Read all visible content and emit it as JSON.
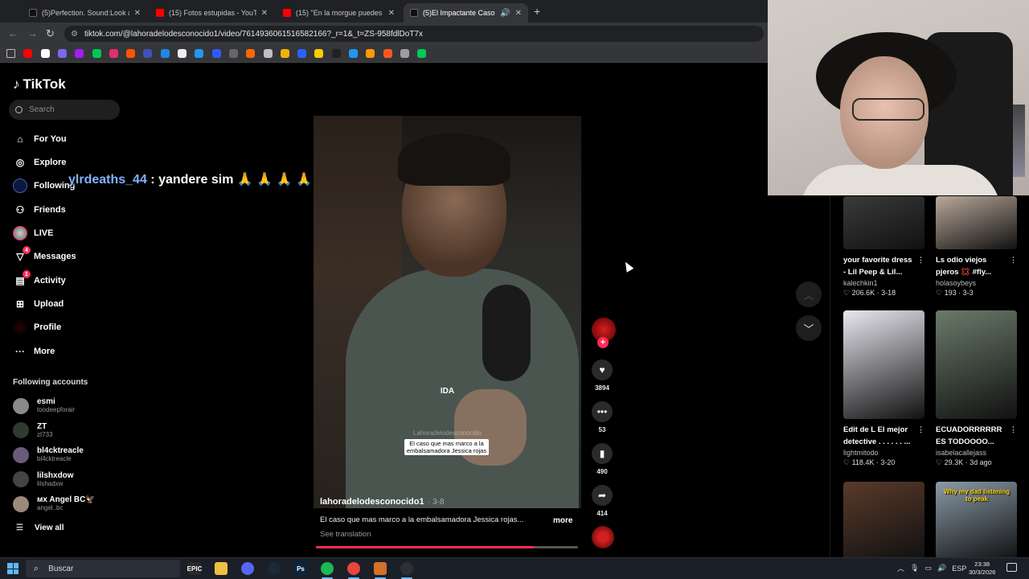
{
  "browser": {
    "tabs": [
      {
        "title": "(5)Perfection. Sound:Look at Me",
        "favicon_color": "#111111",
        "active": false
      },
      {
        "title": "(15) Fotos estupidas - YouTube",
        "favicon_color": "#ff0000",
        "active": false
      },
      {
        "title": "(15) \"En la morgue puedes ver",
        "favicon_color": "#ff0000",
        "active": false
      },
      {
        "title": "(5)El Impactante Caso de Je",
        "favicon_color": "#111111",
        "active": true
      }
    ],
    "url": "tiktok.com/@lahoradelodesconocido1/video/7614936061516582166?_r=1&_t=ZS-958fdlDoT7x",
    "bookmark_colors": [
      "#ea4335",
      "#ff0000",
      "#ffffff",
      "#7b68ee",
      "#a020f0",
      "#00c853",
      "#e1306c",
      "#ff5500",
      "#3f51b5",
      "#1e88e5",
      "#eeeeee",
      "#2196f3",
      "#2f5aff",
      "#666666",
      "#ff6600",
      "#c0c0c0",
      "#f0b400",
      "#2962ff",
      "#ffcc00",
      "#222222",
      "#2196f3",
      "#ff9900",
      "#ff5722",
      "#9e9e9e",
      "#00c853"
    ]
  },
  "tiktok": {
    "logo": "TikTok",
    "search_placeholder": "Search",
    "nav": [
      {
        "label": "For You",
        "icon": "home-icon",
        "glyph": "⌂"
      },
      {
        "label": "Explore",
        "icon": "compass-icon",
        "glyph": "◎"
      },
      {
        "label": "Following",
        "icon": "following-icon",
        "glyph": ""
      },
      {
        "label": "Friends",
        "icon": "friends-icon",
        "glyph": "⚇"
      },
      {
        "label": "LIVE",
        "icon": "live-icon",
        "glyph": ""
      },
      {
        "label": "Messages",
        "icon": "messages-icon",
        "glyph": "▽",
        "badge": "4"
      },
      {
        "label": "Activity",
        "icon": "activity-icon",
        "glyph": "▤",
        "badge": "1"
      },
      {
        "label": "Upload",
        "icon": "upload-icon",
        "glyph": "⊞"
      },
      {
        "label": "Profile",
        "icon": "profile-avatar",
        "glyph": ""
      },
      {
        "label": "More",
        "icon": "more-icon",
        "glyph": "···"
      }
    ],
    "following_accounts_title": "Following accounts",
    "accounts": [
      {
        "name": "esmi",
        "handle": "toodeepforair",
        "color": "#8a8a8a"
      },
      {
        "name": "ZT",
        "handle": "zt733",
        "color": "#2e3b2e"
      },
      {
        "name": "bl4cktreacle",
        "handle": "bl4cktreacle",
        "color": "#6b5a7a"
      },
      {
        "name": "lilshxdow",
        "handle": "lilshadxw",
        "color": "#444444"
      },
      {
        "name": "ᴍx Angel BC🦅",
        "handle": "angel..bc",
        "color": "#9a8a7a"
      }
    ],
    "view_all": "View all"
  },
  "stream_overlay": {
    "username": "ylrdeaths_44",
    "message": " : yandere sim 🙏 🙏 🙏 🙏"
  },
  "video": {
    "center_text": "IDA",
    "watermark": "Lahoradelodesconocido",
    "caption": "El caso que mas marco a la embalsamadora Jessica rojas",
    "author": "lahoradelodesconocido1",
    "date": "· 3-8",
    "description": "El caso que mas marco a la embalsamadora  Jessica rojas...",
    "more": "more",
    "see_translation": "See translation",
    "progress": 0.83,
    "likes": "3894",
    "comments": "53",
    "bookmarks": "490",
    "shares": "414"
  },
  "recommended": [
    {
      "title": "your favorite dress - Lil Peep & Lil...",
      "author": "kalechkin1",
      "stats": "♡ 206.6K · 3-18",
      "thumb": "#3a3a3a"
    },
    {
      "title": "Ls odio viejos pjeros 💢 #fly...",
      "author": "holasoybeys",
      "stats": "♡ 193 · 3-3",
      "thumb": "#b8a89a"
    },
    {
      "title": "Edit de L El mejor detective . . . . . . ...",
      "author": "lightmitodo",
      "stats": "♡ 118.4K · 3-20",
      "thumb": "#e8e8f0"
    },
    {
      "title": "ECUADORRRRRR ES TODOOOO...",
      "author": "isabelacallejass",
      "stats": "♡ 29.3K · 3d ago",
      "thumb": "#6a7a6a"
    },
    {
      "title": "",
      "author": "",
      "stats": "",
      "thumb": "#5a3a2a"
    },
    {
      "title": "Why my dad listening to peak",
      "author": "",
      "stats": "",
      "thumb": "#8a9aa8"
    }
  ],
  "taskbar": {
    "search_placeholder": "Buscar",
    "apps": [
      {
        "name": "epic-games-app",
        "label": "EPIC",
        "color": "#2a2a2a"
      },
      {
        "name": "file-explorer-app",
        "label": "",
        "color": "#f0c040"
      },
      {
        "name": "discord-app",
        "label": "",
        "color": "#5865f2"
      },
      {
        "name": "steam-app",
        "label": "",
        "color": "#1b2838"
      },
      {
        "name": "photoshop-app",
        "label": "Ps",
        "color": "#0a2540"
      },
      {
        "name": "spotify-app",
        "label": "",
        "color": "#1db954"
      },
      {
        "name": "chrome-app",
        "label": "",
        "color": "#e8453c"
      },
      {
        "name": "app-shield",
        "label": "",
        "color": "#d4702a"
      },
      {
        "name": "obs-app",
        "label": "",
        "color": "#302e31"
      }
    ],
    "language": "ESP",
    "time": "23:38",
    "date": "30/3/2026"
  }
}
